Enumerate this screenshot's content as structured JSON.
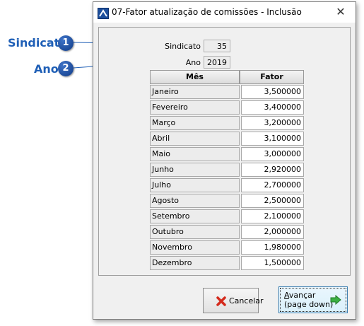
{
  "callouts": [
    {
      "label": "Sindicato",
      "badge": "1"
    },
    {
      "label": "Ano",
      "badge": "2"
    }
  ],
  "window": {
    "title": "07-Fator atualização de comissões - Inclusão",
    "close_glyph": "✕",
    "icon": "app-icon"
  },
  "form": {
    "sindicato_label": "Sindicato",
    "sindicato_value": "35",
    "ano_label": "Ano",
    "ano_value": "2019"
  },
  "grid": {
    "columns": [
      "Mês",
      "Fator"
    ],
    "rows": [
      {
        "mes": "Janeiro",
        "fator": "3,500000"
      },
      {
        "mes": "Fevereiro",
        "fator": "3,400000"
      },
      {
        "mes": "Março",
        "fator": "3,200000"
      },
      {
        "mes": "Abril",
        "fator": "3,100000"
      },
      {
        "mes": "Maio",
        "fator": "3,000000"
      },
      {
        "mes": "Junho",
        "fator": "2,920000"
      },
      {
        "mes": "Julho",
        "fator": "2,700000"
      },
      {
        "mes": "Agosto",
        "fator": "2,500000"
      },
      {
        "mes": "Setembro",
        "fator": "2,100000"
      },
      {
        "mes": "Outubro",
        "fator": "2,000000"
      },
      {
        "mes": "Novembro",
        "fator": "1,980000"
      },
      {
        "mes": "Dezembro",
        "fator": "1,500000"
      }
    ]
  },
  "buttons": {
    "cancel_label": "Cancelar",
    "cancel_icon": "red-x-icon",
    "next_label_underlined": "A",
    "next_label_rest": "vançar",
    "next_sublabel": "(page down)",
    "next_icon": "green-arrow-right-icon"
  },
  "colors": {
    "callout_blue": "#1f5fb6",
    "badge_blue": "#1a4ea0",
    "window_bg": "#f0f0f0",
    "focus_border": "#3c7fb1"
  }
}
